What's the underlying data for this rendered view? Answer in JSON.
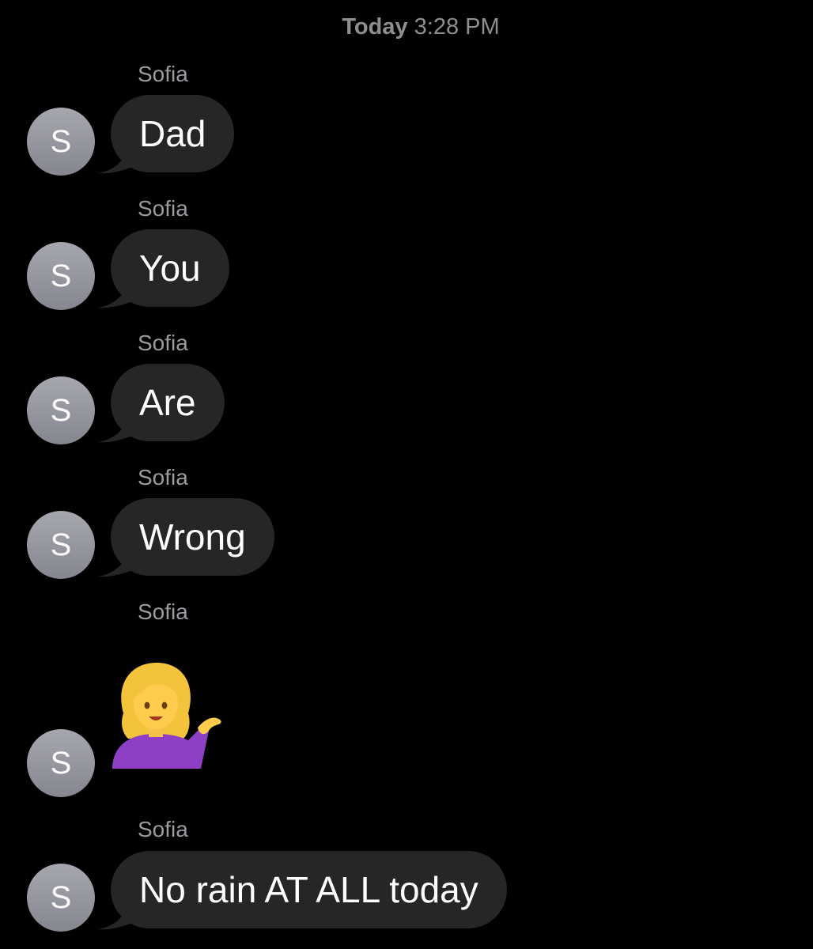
{
  "header": {
    "timestamp_day": "Today",
    "timestamp_time": "3:28 PM"
  },
  "messages": [
    {
      "sender": "Sofia",
      "avatar_initial": "S",
      "text": "Dad"
    },
    {
      "sender": "Sofia",
      "avatar_initial": "S",
      "text": "You"
    },
    {
      "sender": "Sofia",
      "avatar_initial": "S",
      "text": "Are"
    },
    {
      "sender": "Sofia",
      "avatar_initial": "S",
      "text": "Wrong"
    },
    {
      "sender": "Sofia",
      "avatar_initial": "S",
      "emoji": "woman-tipping-hand"
    },
    {
      "sender": "Sofia",
      "avatar_initial": "S",
      "text": "No rain AT ALL today"
    }
  ],
  "colors": {
    "background": "#000000",
    "bubble": "#262628",
    "sender_label": "#9a9aa0",
    "timestamp": "#8e8e93",
    "avatar": "#9a9ba2"
  }
}
